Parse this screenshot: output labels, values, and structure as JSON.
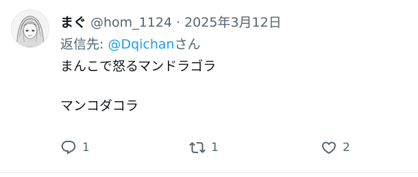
{
  "tweet": {
    "display_name": "まぐ",
    "handle": "@hom_1124",
    "separator": "·",
    "date": "2025年3月12日",
    "reply_prefix": "返信先: ",
    "reply_mention": "@Dqichan",
    "reply_suffix": "さん",
    "text_lines": [
      "まんこで怒るマンドラゴラ",
      "マンコダコラ"
    ],
    "actions": {
      "reply_count": "1",
      "retweet_count": "1",
      "like_count": "2"
    }
  },
  "colors": {
    "text_primary": "#0f1419",
    "text_secondary": "#536471",
    "mention": "#1d9bf0",
    "divider": "#e7e9ea"
  },
  "icons": [
    "avatar",
    "reply-icon",
    "retweet-icon",
    "like-icon"
  ]
}
